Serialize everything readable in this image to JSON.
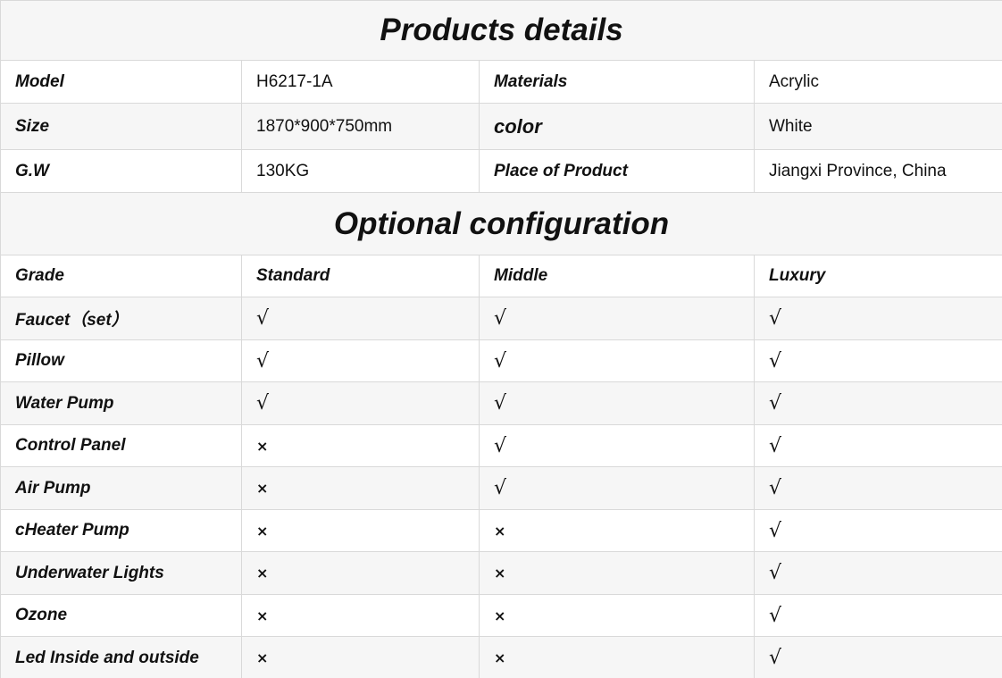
{
  "details": {
    "title": "Products details",
    "rows": [
      {
        "label1": "Model",
        "value1": "H6217-1A",
        "label2": "Materials",
        "value2": "Acrylic"
      },
      {
        "label1": "Size",
        "value1": "1870*900*750mm",
        "label2": "color",
        "value2": "White"
      },
      {
        "label1": "G.W",
        "value1": "130KG",
        "label2": "Place of Product",
        "value2": "Jiangxi Province, China"
      }
    ]
  },
  "config": {
    "title": "Optional configuration",
    "headers": [
      "Grade",
      "Standard",
      "Middle",
      "Luxury"
    ],
    "rows": [
      {
        "name": "Faucet（set）",
        "standard": "√",
        "middle": "√",
        "luxury": "√"
      },
      {
        "name": "Pillow",
        "standard": "√",
        "middle": "√",
        "luxury": "√"
      },
      {
        "name": "Water Pump",
        "standard": "√",
        "middle": "√",
        "luxury": "√"
      },
      {
        "name": "Control Panel",
        "standard": "×",
        "middle": "√",
        "luxury": "√"
      },
      {
        "name": "Air Pump",
        "standard": "×",
        "middle": "√",
        "luxury": "√"
      },
      {
        "name": "cHeater Pump",
        "standard": "×",
        "middle": "×",
        "luxury": "√"
      },
      {
        "name": "Underwater Lights",
        "standard": "×",
        "middle": "×",
        "luxury": "√"
      },
      {
        "name": "Ozone",
        "standard": "×",
        "middle": "×",
        "luxury": "√"
      },
      {
        "name": "Led Inside and outside",
        "standard": "×",
        "middle": "×",
        "luxury": "√"
      }
    ]
  }
}
